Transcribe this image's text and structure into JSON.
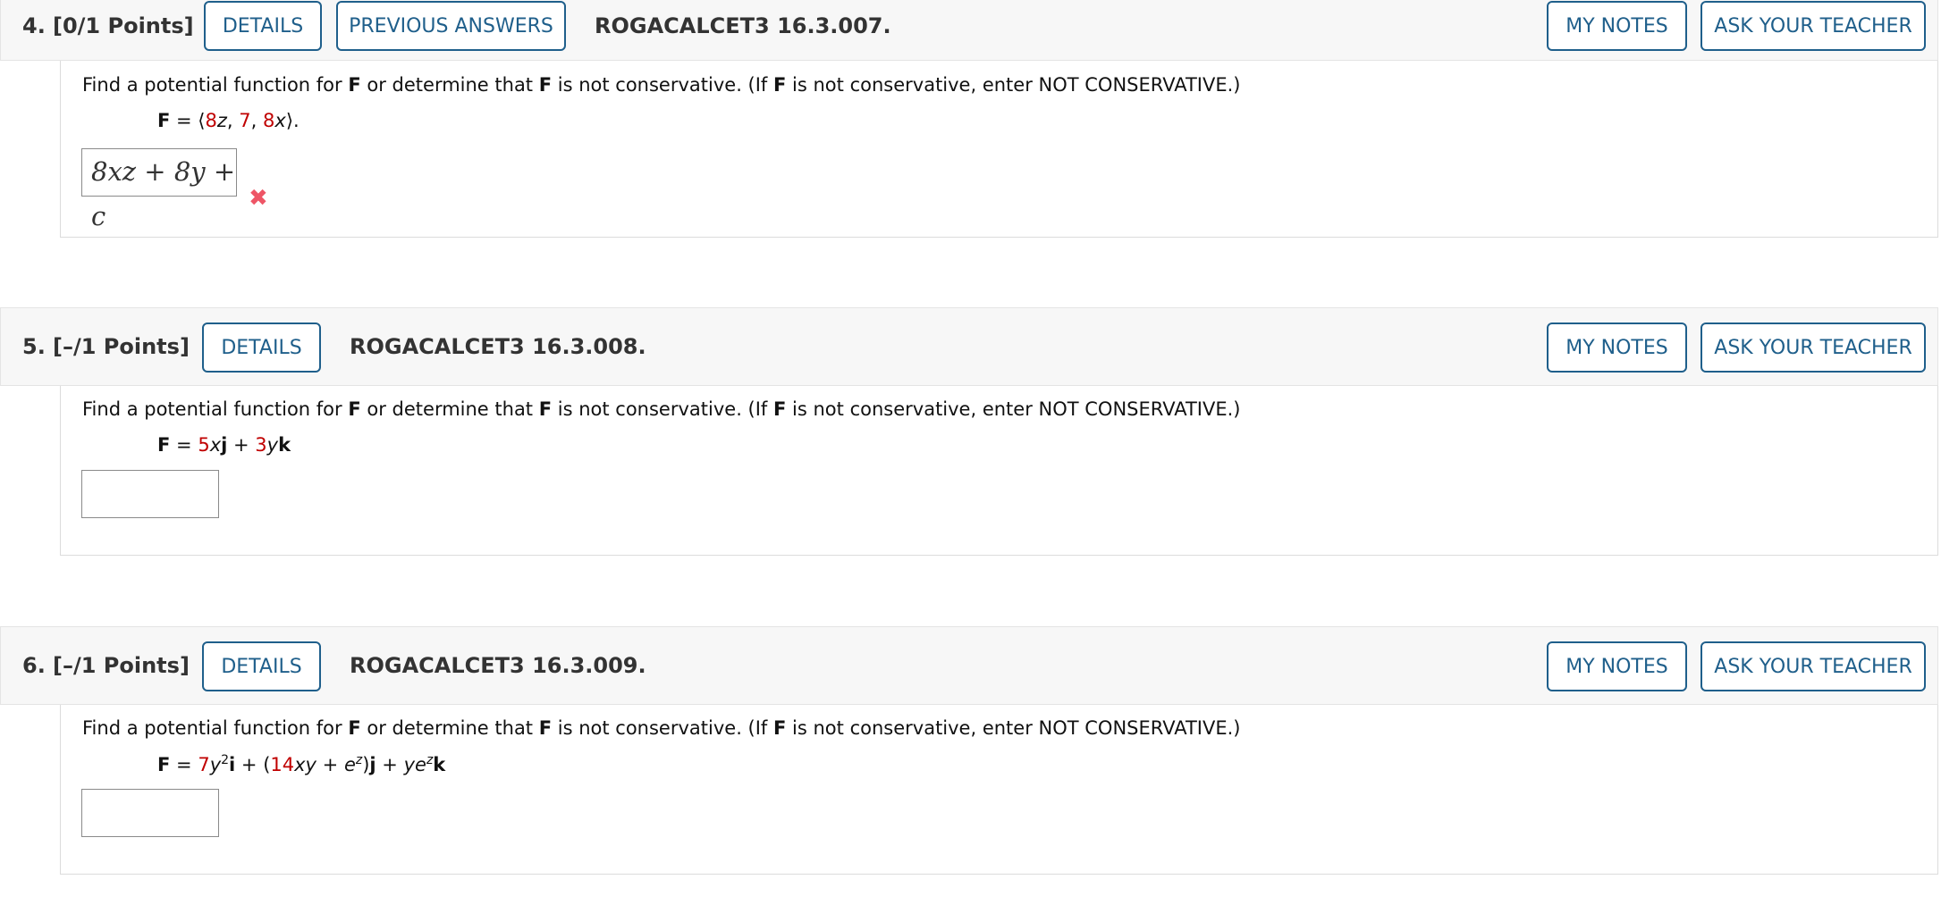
{
  "questions": [
    {
      "number": "4.",
      "points": "[0/1 Points]",
      "details_label": "DETAILS",
      "previous_answers_label": "PREVIOUS ANSWERS",
      "code": "ROGACALCET3 16.3.007.",
      "my_notes_label": "MY NOTES",
      "ask_teacher_label": "ASK YOUR TEACHER",
      "prompt": {
        "p1": "Find a potential function for ",
        "F": "F",
        "p2": " or determine that ",
        "p3": " is not conservative. (If ",
        "p4": " is not conservative, enter NOT CONSERVATIVE.)"
      },
      "formula": {
        "F": "F",
        "eq": " = ⟨",
        "a": "8",
        "z": "z",
        "c1": ", ",
        "b": "7",
        "c2": ", ",
        "c": "8",
        "x": "x",
        "end": "⟩."
      },
      "answer": "8xz + 8y + c",
      "status": "incorrect"
    },
    {
      "number": "5.",
      "points": "[–/1 Points]",
      "details_label": "DETAILS",
      "code": "ROGACALCET3 16.3.008.",
      "my_notes_label": "MY NOTES",
      "ask_teacher_label": "ASK YOUR TEACHER",
      "prompt": {
        "p1": "Find a potential function for ",
        "F": "F",
        "p2": " or determine that ",
        "p3": " is not conservative. (If ",
        "p4": " is not conservative, enter NOT CONSERVATIVE.)"
      },
      "formula": {
        "F": "F",
        "eq": " = ",
        "a": "5",
        "x": "x",
        "j": "j",
        "plus": " + ",
        "b": "3",
        "y": "y",
        "k": "k"
      },
      "answer": ""
    },
    {
      "number": "6.",
      "points": "[–/1 Points]",
      "details_label": "DETAILS",
      "code": "ROGACALCET3 16.3.009.",
      "my_notes_label": "MY NOTES",
      "ask_teacher_label": "ASK YOUR TEACHER",
      "prompt": {
        "p1": "Find a potential function for ",
        "F": "F",
        "p2": " or determine that ",
        "p3": " is not conservative. (If ",
        "p4": " is not conservative, enter NOT CONSERVATIVE.)"
      },
      "formula": {
        "F": "F",
        "eq": " = ",
        "a": "7",
        "y": "y",
        "sup2": "2",
        "i": "i",
        "open": " + (",
        "b": "14",
        "xy": "xy",
        "plus_e": " + ",
        "e": "e",
        "supz": "z",
        "close": ")",
        "j": "j",
        "plus2": " + ",
        "ye": "ye",
        "supz2": "z",
        "k": "k"
      },
      "answer": ""
    }
  ]
}
